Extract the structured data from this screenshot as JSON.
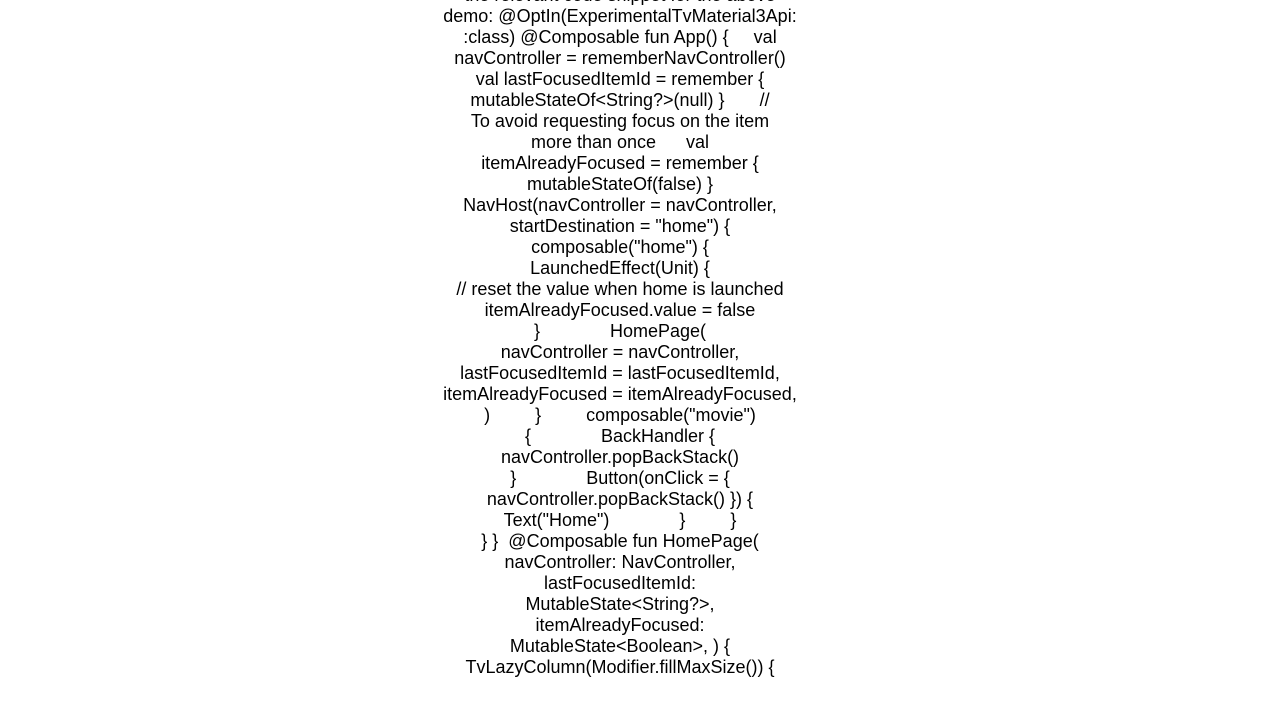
{
  "document": {
    "lines": [
      "the relevant code snippet for the above",
      "demo: @OptIn(ExperimentalTvMaterial3Api:",
      ":class) @Composable fun App() {     val",
      "navController = rememberNavController()",
      "val lastFocusedItemId = remember {",
      "mutableStateOf<String?>(null) }       //",
      "To avoid requesting focus on the item",
      "more than once      val",
      "itemAlreadyFocused = remember {",
      "mutableStateOf(false) }",
      "NavHost(navController = navController,",
      "startDestination = \"home\") {",
      "composable(\"home\") {",
      "LaunchedEffect(Unit) {",
      "// reset the value when home is launched",
      "itemAlreadyFocused.value = false",
      "}              HomePage(",
      "navController = navController,",
      "lastFocusedItemId = lastFocusedItemId,",
      "itemAlreadyFocused = itemAlreadyFocused,",
      ")         }         composable(\"movie\")",
      "{              BackHandler {",
      "navController.popBackStack()",
      "}              Button(onClick = {",
      "navController.popBackStack() }) {",
      "Text(\"Home\")              }         }",
      "} }  @Composable fun HomePage(",
      "navController: NavController,",
      "lastFocusedItemId:",
      "MutableState<String?>,",
      "itemAlreadyFocused:",
      "MutableState<Boolean>, ) {",
      "TvLazyColumn(Modifier.fillMaxSize()) {"
    ]
  }
}
